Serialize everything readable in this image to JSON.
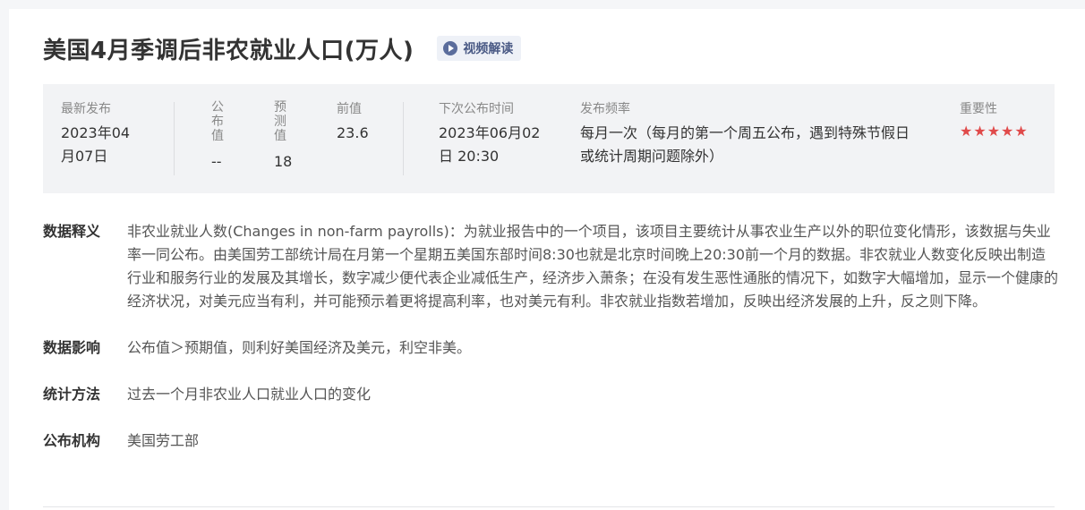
{
  "header": {
    "title": "美国4月季调后非农就业人口(万人)",
    "video_label": "视频解读"
  },
  "info": {
    "latest_label": "最新发布",
    "latest_value": "2023年04月07日",
    "actual_label": "公布值",
    "actual_value": "--",
    "forecast_label": "预测值",
    "forecast_value": "18",
    "previous_label": "前值",
    "previous_value": "23.6",
    "next_label": "下次公布时间",
    "next_value": "2023年06月02日 20:30",
    "freq_label": "发布频率",
    "freq_value": "每月一次（每月的第一个周五公布，遇到特殊节假日或统计周期问题除外）",
    "importance_label": "重要性",
    "importance_rating": 5,
    "importance_stars": "★★★★★"
  },
  "details": [
    {
      "key": "数据释义",
      "value": "非农业就业人数(Changes in non-farm payrolls)：为就业报告中的一个项目，该项目主要统计从事农业生产以外的职位变化情形，该数据与失业率一同公布。由美国劳工部统计局在月第一个星期五美国东部时间8:30也就是北京时间晚上20:30前一个月的数据。非农就业人数变化反映出制造行业和服务行业的发展及其增长，数字减少便代表企业减低生产，经济步入萧条；在没有发生恶性通胀的情况下，如数字大幅增加，显示一个健康的经济状况，对美元应当有利，并可能预示着更将提高利率，也对美元有利。非农就业指数若增加，反映出经济发展的上升，反之则下降。"
    },
    {
      "key": "数据影响",
      "value": "公布值＞预期值，则利好美国经济及美元，利空非美。"
    },
    {
      "key": "统计方法",
      "value": "过去一个月非农业人口就业人口的变化"
    },
    {
      "key": "公布机构",
      "value": "美国劳工部"
    }
  ],
  "colors": {
    "star": "#e04a4a",
    "badge_bg": "#eef1f7",
    "info_bg": "#f2f3f5"
  }
}
